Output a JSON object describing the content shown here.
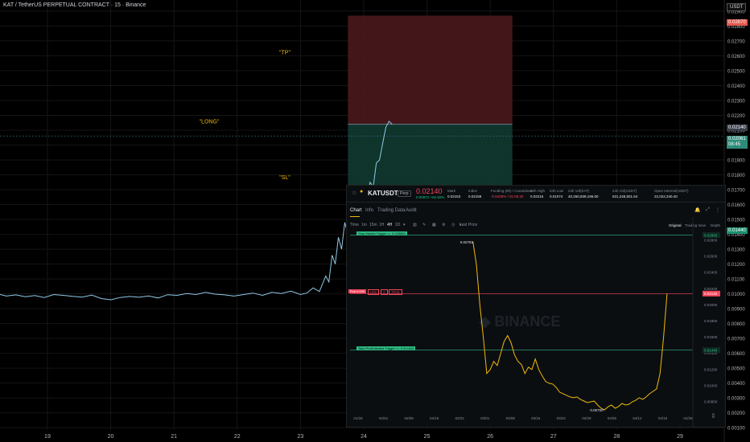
{
  "main": {
    "title": "KAT / TetherUS PERPETUAL CONTRACT · 15 · Binance",
    "currency": "USDT",
    "labels": {
      "long": "\"LONG\"",
      "tp": "\"TP\"",
      "sl": "\"SL\""
    },
    "price_tags": {
      "red": "0.02870",
      "last": "0.02140",
      "green_top": "0.02061",
      "green_sub": "08:45",
      "sl": "0.01440"
    },
    "event_marker": "E",
    "colors": {
      "tp_zone": "#4a1a1c",
      "sl_zone": "#0f3a30",
      "line": "#8fc8e6",
      "grid": "#151515"
    }
  },
  "inset": {
    "symbol": "KATUSDT",
    "badge": "Perp",
    "last_price": "0.02140",
    "change": "0.00872 +82.50%",
    "stats": [
      {
        "label": "Mark",
        "value": "0.02153"
      },
      {
        "label": "Index",
        "value": "0.02159"
      },
      {
        "label": "Funding (8h) / Countdown",
        "value": "-0.5436% / 01:05:32"
      },
      {
        "label": "24h High",
        "value": "0.02216"
      },
      {
        "label": "24h Low",
        "value": "0.01074"
      },
      {
        "label": "24h Vol(KAT)",
        "value": "40,260,839,196.00"
      },
      {
        "label": "24h Vol(USDT)",
        "value": "631,248,501.64"
      },
      {
        "label": "Open Interest(USDT)",
        "value": "22,022,340.40"
      }
    ],
    "tabs": [
      "Chart",
      "Info",
      "Trading Data",
      "Audit"
    ],
    "intervals": [
      "Time",
      "1m",
      "15m",
      "1H",
      "4H",
      "1D"
    ],
    "price_type": "Last Price",
    "view_modes": [
      "Original",
      "Trading View",
      "Depth"
    ],
    "orders": {
      "stop": "Stop Market Trigger >= 0.028650",
      "entry": "Pos 0.020",
      "entry_btns": [
        "USD",
        "X",
        "TP/SL"
      ],
      "tp": "Take Profit Market Trigger <= 0.014410"
    },
    "price_tags": {
      "stop": "0.02865",
      "last": "0.02140",
      "tp": "0.01440"
    },
    "annotations": {
      "high": "0.02783",
      "low": "0.00700"
    },
    "watermark": "BINANCE",
    "colors": {
      "line": "#f0b90b",
      "order_line": "#2ebd85",
      "entry_line": "#f6465d"
    }
  },
  "chart_data": [
    {
      "type": "line",
      "title": "KAT / TetherUS PERPETUAL CONTRACT · 15 · Binance",
      "xlabel": "",
      "ylabel": "",
      "x_ticks": [
        "19",
        "20",
        "21",
        "22",
        "23",
        "24",
        "25",
        "26",
        "27",
        "28",
        "29"
      ],
      "y_ticks": [
        "0.02900",
        "0.02800",
        "0.02700",
        "0.02600",
        "0.02500",
        "0.02400",
        "0.02300",
        "0.02200",
        "0.02100",
        "0.02000",
        "0.01900",
        "0.01800",
        "0.01700",
        "0.01600",
        "0.01500",
        "0.01400",
        "0.01300",
        "0.01200",
        "0.01100",
        "0.01000",
        "0.00900",
        "0.00800",
        "0.00700",
        "0.00600",
        "0.00500",
        "0.00400",
        "0.00300",
        "0.00200",
        "0.00100"
      ],
      "ylim": [
        0.00085,
        0.02975
      ],
      "xlim": [
        18.25,
        29.7
      ],
      "series": [
        {
          "x": [
            18.25,
            18.35,
            18.5,
            18.65,
            18.8,
            18.95,
            19.1,
            19.25,
            19.4,
            19.55,
            19.7,
            19.85,
            20.0,
            20.15,
            20.3,
            20.45,
            20.6,
            20.75,
            20.9,
            21.05,
            21.2,
            21.35,
            21.5,
            21.65,
            21.8,
            21.95,
            22.1,
            22.25,
            22.4,
            22.55,
            22.7,
            22.85,
            23.0,
            23.1,
            23.2,
            23.3,
            23.4,
            23.45,
            23.5,
            23.55,
            23.6,
            23.65,
            23.7,
            23.75,
            23.8,
            23.85,
            23.9,
            23.95,
            24.0,
            24.05,
            24.1,
            24.15,
            24.2,
            24.25,
            24.3,
            24.35,
            24.4,
            24.45
          ],
          "values": [
            0.00996,
            0.00985,
            0.00993,
            0.0098,
            0.00988,
            0.00975,
            0.00995,
            0.0099,
            0.00983,
            0.00978,
            0.00992,
            0.00968,
            0.0096,
            0.00975,
            0.00982,
            0.00977,
            0.00986,
            0.00972,
            0.00994,
            0.0099,
            0.01002,
            0.00995,
            0.0101,
            0.00998,
            0.00993,
            0.00985,
            0.00995,
            0.01005,
            0.0099,
            0.0101,
            0.01002,
            0.01018,
            0.00995,
            0.01005,
            0.0104,
            0.01015,
            0.0112,
            0.0108,
            0.0126,
            0.012,
            0.0138,
            0.013,
            0.0148,
            0.014,
            0.0156,
            0.015,
            0.0153,
            0.0161,
            0.0166,
            0.0164,
            0.0175,
            0.0172,
            0.0188,
            0.019,
            0.0201,
            0.0212,
            0.0216,
            0.0214
          ]
        }
      ],
      "position": {
        "entry": 0.0214,
        "take_profit": 0.0287,
        "stop_loss": 0.0144,
        "start_x": 23.75,
        "end_x": 26.35
      }
    },
    {
      "type": "line",
      "title": "KATUSDT",
      "x_ticks": [
        "01/25",
        "02/01",
        "02/08",
        "02/15",
        "02/22",
        "03/01",
        "03/08",
        "03/15",
        "03/22",
        "03/29",
        "04/05",
        "04/12",
        "04/19",
        "04/26"
      ],
      "y_ticks": [
        "0.02800",
        "0.02600",
        "0.02400",
        "0.02200",
        "0.02000",
        "0.01800",
        "0.01600",
        "0.01400",
        "0.01200",
        "0.01000",
        "0.00800"
      ],
      "ylim": [
        0.0071,
        0.029
      ],
      "xlim": [
        0,
        98
      ],
      "series": [
        {
          "x": [
            35,
            36,
            37,
            38,
            39,
            40,
            41,
            42,
            43,
            44,
            45,
            46,
            47,
            48,
            49,
            50,
            51,
            52,
            53,
            54,
            55,
            56,
            57,
            58,
            59,
            60,
            61,
            62,
            63,
            64,
            65,
            66,
            67,
            68,
            69,
            70,
            71,
            72,
            73,
            74,
            75,
            76,
            77,
            78,
            79,
            80,
            81,
            82,
            83,
            84,
            85,
            86,
            87,
            88,
            89,
            90,
            91
          ],
          "values": [
            0.02783,
            0.025,
            0.02,
            0.016,
            0.0115,
            0.012,
            0.013,
            0.0125,
            0.014,
            0.0155,
            0.0162,
            0.0153,
            0.0138,
            0.013,
            0.0126,
            0.0115,
            0.0123,
            0.012,
            0.0133,
            0.012,
            0.0112,
            0.0105,
            0.0103,
            0.0102,
            0.0098,
            0.0092,
            0.009,
            0.0088,
            0.0086,
            0.0085,
            0.0086,
            0.0083,
            0.0081,
            0.0079,
            0.008,
            0.0081,
            0.0076,
            0.0072,
            0.007,
            0.0074,
            0.0076,
            0.0072,
            0.0074,
            0.0078,
            0.0076,
            0.0077,
            0.008,
            0.0082,
            0.0085,
            0.0083,
            0.0086,
            0.009,
            0.0093,
            0.0096,
            0.0115,
            0.016,
            0.0214
          ]
        }
      ]
    }
  ]
}
